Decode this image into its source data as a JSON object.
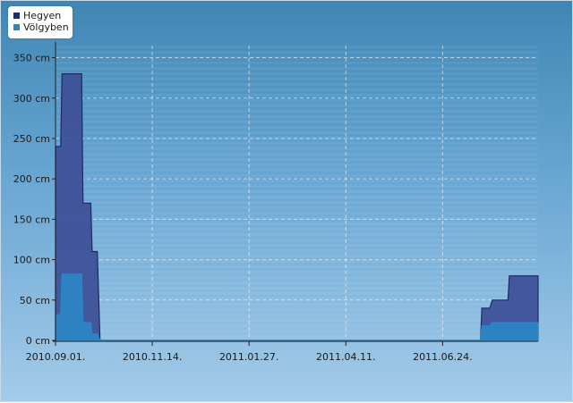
{
  "chart_data": {
    "type": "area",
    "x_ticks": [
      "2010.09.01.",
      "2010.11.14.",
      "2011.01.27.",
      "2011.04.11.",
      "2011.06.24."
    ],
    "y_ticks": [
      0,
      50,
      100,
      150,
      200,
      250,
      300,
      350
    ],
    "y_unit": "cm",
    "ylim": [
      0,
      365
    ],
    "xlim": [
      "2010.09.01.",
      "2011.09.05."
    ],
    "grid": true,
    "legend_position": "top-left",
    "series": [
      {
        "name": "Hegyen",
        "color": "#3d4e96",
        "outline": "#1f2a63",
        "points": [
          [
            "2010.09.01.",
            240
          ],
          [
            "2010.09.05.",
            240
          ],
          [
            "2010.09.06.",
            330
          ],
          [
            "2010.09.21.",
            330
          ],
          [
            "2010.09.22.",
            170
          ],
          [
            "2010.09.28.",
            170
          ],
          [
            "2010.09.29.",
            110
          ],
          [
            "2010.10.03.",
            110
          ],
          [
            "2010.10.04.",
            55
          ],
          [
            "2010.10.05.",
            0
          ],
          [
            "2011.07.23.",
            0
          ],
          [
            "2011.07.24.",
            40
          ],
          [
            "2011.07.30.",
            40
          ],
          [
            "2011.08.01.",
            50
          ],
          [
            "2011.08.13.",
            50
          ],
          [
            "2011.08.14.",
            80
          ],
          [
            "2011.09.05.",
            80
          ]
        ]
      },
      {
        "name": "Völgyben",
        "color": "#2c86c6",
        "outline": "#2c86c6",
        "points": [
          [
            "2010.09.01.",
            32
          ],
          [
            "2010.09.05.",
            32
          ],
          [
            "2010.09.06.",
            82
          ],
          [
            "2010.09.21.",
            82
          ],
          [
            "2010.09.22.",
            22
          ],
          [
            "2010.09.28.",
            22
          ],
          [
            "2010.09.29.",
            8
          ],
          [
            "2010.10.03.",
            8
          ],
          [
            "2010.10.05.",
            0
          ],
          [
            "2011.07.23.",
            0
          ],
          [
            "2011.07.24.",
            18
          ],
          [
            "2011.07.30.",
            18
          ],
          [
            "2011.08.01.",
            22
          ],
          [
            "2011.09.05.",
            22
          ]
        ]
      }
    ]
  }
}
